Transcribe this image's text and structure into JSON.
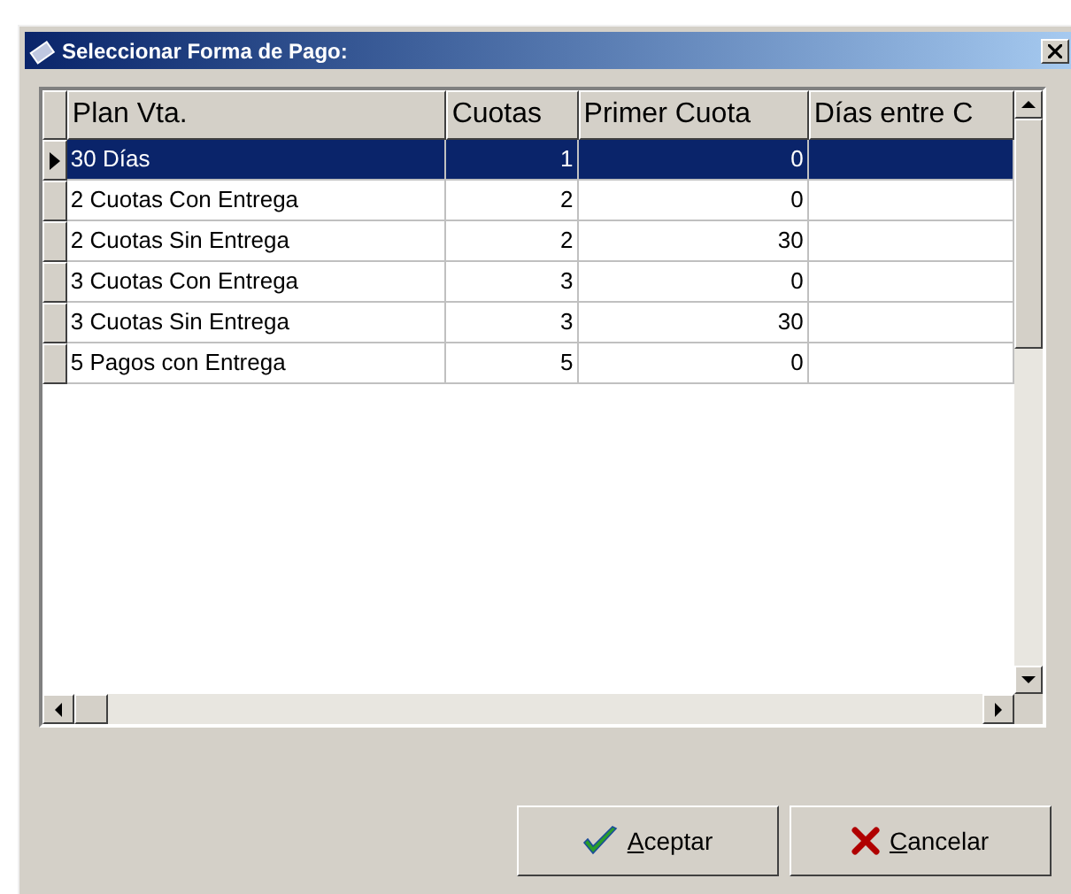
{
  "window": {
    "title": "Seleccionar Forma de Pago:"
  },
  "table": {
    "columns": [
      "Plan Vta.",
      "Cuotas",
      "Primer Cuota",
      "Días entre C"
    ],
    "rows": [
      {
        "cells": [
          "30 Días",
          "1",
          "0",
          ""
        ],
        "selected": true
      },
      {
        "cells": [
          "2 Cuotas Con Entrega",
          "2",
          "0",
          ""
        ],
        "selected": false
      },
      {
        "cells": [
          "2 Cuotas Sin Entrega",
          "2",
          "30",
          ""
        ],
        "selected": false
      },
      {
        "cells": [
          "3 Cuotas Con Entrega",
          "3",
          "0",
          ""
        ],
        "selected": false
      },
      {
        "cells": [
          "3 Cuotas Sin Entrega",
          "3",
          "30",
          ""
        ],
        "selected": false
      },
      {
        "cells": [
          "5 Pagos con Entrega",
          "5",
          "0",
          ""
        ],
        "selected": false
      }
    ]
  },
  "buttons": [
    {
      "kind": "ok",
      "label": "Aceptar"
    },
    {
      "kind": "cancel",
      "label": "Cancelar"
    }
  ]
}
